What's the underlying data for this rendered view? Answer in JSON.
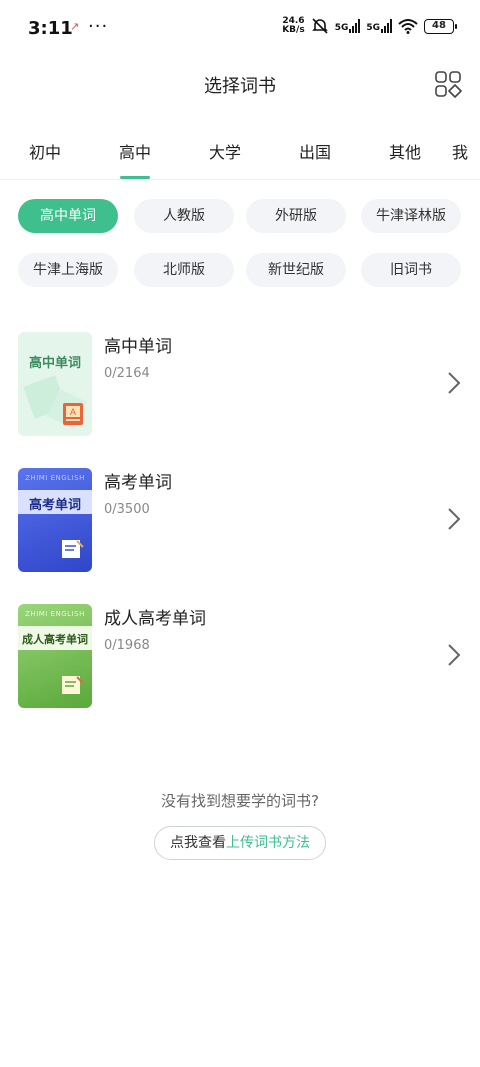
{
  "status_bar": {
    "time": "3:11",
    "alert_icon": "↗",
    "dots": "···",
    "net_speed_value": "24.6",
    "net_speed_unit": "KB/s",
    "sig1_label": "5G",
    "sig2_label": "5G",
    "battery": "48"
  },
  "header": {
    "title": "选择词书",
    "menu_icon": "grid-icon"
  },
  "tabs": [
    "初中",
    "高中",
    "大学",
    "出国",
    "其他",
    "我"
  ],
  "selected_tab": "高中",
  "chips": [
    "高中单词",
    "人教版",
    "外研版",
    "牛津译林版",
    "牛津上海版",
    "北师版",
    "新世纪版",
    "旧词书"
  ],
  "selected_chip": "高中单词",
  "books": [
    {
      "name": "高中单词",
      "count": "0/2164",
      "cover_title": "高中单词",
      "cover_icon": "book-icon",
      "cover_colors": [
        "#e4f5ec",
        "#c6ead7"
      ]
    },
    {
      "name": "高考单词",
      "count": "0/3500",
      "cover_title": "高考单词",
      "cover_banner": "ZHIMI ENGLISH",
      "cover_icon": "notebook-icon",
      "cover_colors": [
        "#4f68e8",
        "#2f46c9"
      ]
    },
    {
      "name": "成人高考单词",
      "count": "0/1968",
      "cover_title": "成人高考单词",
      "cover_banner": "ZHIMI ENGLISH",
      "cover_icon": "notebook-icon",
      "cover_colors": [
        "#8ccf6a",
        "#5aa83a"
      ]
    }
  ],
  "footer": {
    "not_found": "没有找到想要学的词书?",
    "help_prefix": "点我查看",
    "help_link": "上传词书方法"
  },
  "colors": {
    "accent": "#3fbf8e"
  }
}
